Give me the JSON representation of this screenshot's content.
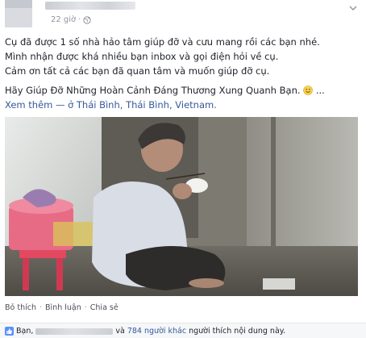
{
  "post": {
    "time": "22 giờ",
    "lines": [
      "Cụ đã được 1 số nhà hảo tâm giúp đỡ và cưu mang rồi các bạn nhé.",
      "Mình nhận được khá nhiều bạn inbox và gọi điện hỏi về cụ.",
      "Cảm ơn tất cả các bạn đã quan tâm và muốn giúp đỡ cụ."
    ],
    "highlight": "Hãy Giúp Đỡ Những Hoàn Cảnh Đáng Thương Xung Quanh Bạn.",
    "ellipsis": "...",
    "see_more": "Xem thêm",
    "location_prefix": "— ở",
    "location_city": "Thái Bình, Thái Bình,",
    "location_country": "Vietnam",
    "location_end": "."
  },
  "actions": {
    "like": "Bỏ thích",
    "comment": "Bình luận",
    "share": "Chia sẻ",
    "separator": "·"
  },
  "likes": {
    "prefix": "Bạn,",
    "conjunction": "và",
    "others": "784 người khác",
    "suffix": "người thích nội dung này."
  },
  "icons": {
    "globe": "globe-icon",
    "chevron": "chevron-down-icon",
    "smiley": "smiley-icon",
    "like": "thumbs-up-icon"
  },
  "colors": {
    "link": "#365899",
    "meta": "#90949c",
    "text": "#1d2129",
    "like_blue": "#5890ff"
  }
}
